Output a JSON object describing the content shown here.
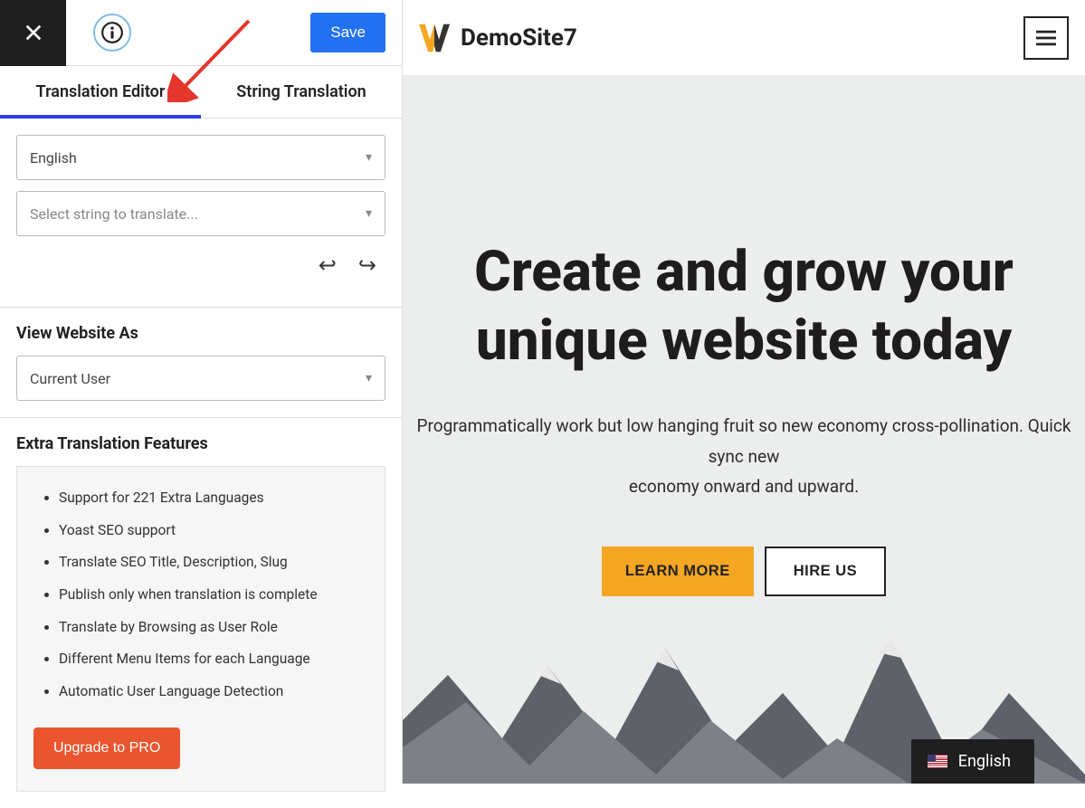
{
  "sidebar": {
    "save_label": "Save",
    "tabs": {
      "editor": "Translation Editor",
      "string": "String Translation"
    },
    "lang_select": "English",
    "string_placeholder": "Select string to translate...",
    "view_as_label": "View Website As",
    "view_as_value": "Current User",
    "extra_label": "Extra Translation Features",
    "features": [
      "Support for 221 Extra Languages",
      "Yoast SEO support",
      "Translate SEO Title, Description, Slug",
      "Publish only when translation is complete",
      "Translate by Browsing as User Role",
      "Different Menu Items for each Language",
      "Automatic User Language Detection"
    ],
    "upgrade_label": "Upgrade to PRO"
  },
  "preview": {
    "site_name": "DemoSite7",
    "hero_title": "Create and grow your unique website today",
    "hero_sub_1": "Programmatically work but low hanging fruit so new economy cross-pollination. Quick sync new",
    "hero_sub_2": "economy onward and upward.",
    "cta_primary": "LEARN MORE",
    "cta_secondary": "HIRE US",
    "lang_switch": "English"
  }
}
